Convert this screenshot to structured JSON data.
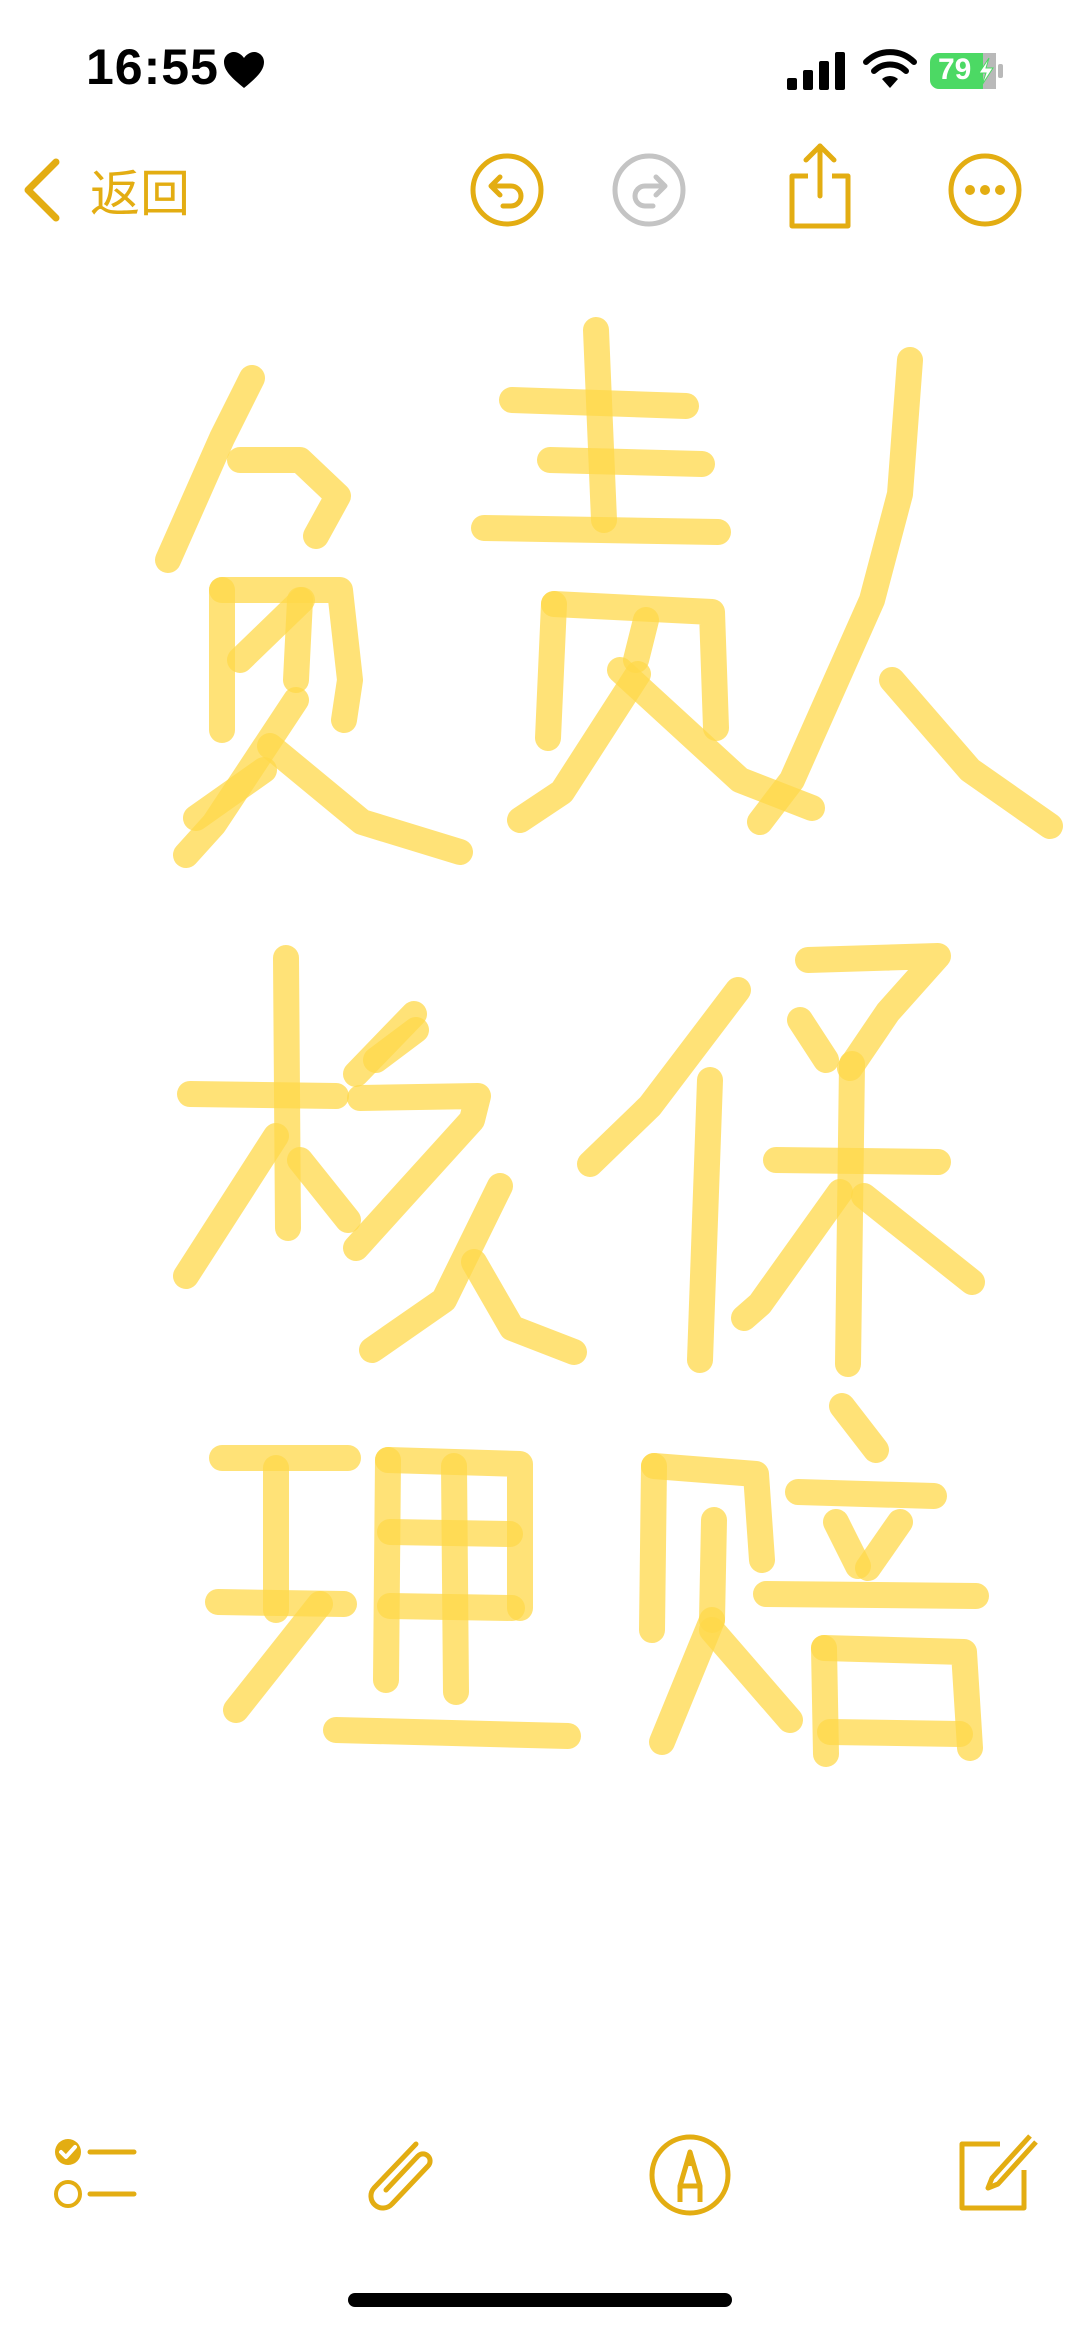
{
  "status_bar": {
    "time": "16:55",
    "battery_level": "79",
    "battery_percent": 79,
    "icons": [
      "heart-icon",
      "cellular-signal-icon",
      "wifi-icon",
      "battery-charging-icon"
    ]
  },
  "nav": {
    "back_label": "返回",
    "icons": [
      "back-chevron-icon",
      "undo-icon",
      "redo-icon",
      "share-icon",
      "more-icon"
    ],
    "redo_enabled": false
  },
  "drawing": {
    "handwritten_text": [
      "负责人",
      "核保",
      "理赔"
    ],
    "stroke_color": "#FFD84A"
  },
  "toolbar": {
    "icons": [
      "checklist-icon",
      "attachment-paperclip-icon",
      "markup-pen-icon",
      "compose-icon"
    ]
  },
  "colors": {
    "accent": "#E3AD12",
    "disabled": "#C4C4C4",
    "battery_green": "#4CD964",
    "background": "#FFFFFF"
  }
}
